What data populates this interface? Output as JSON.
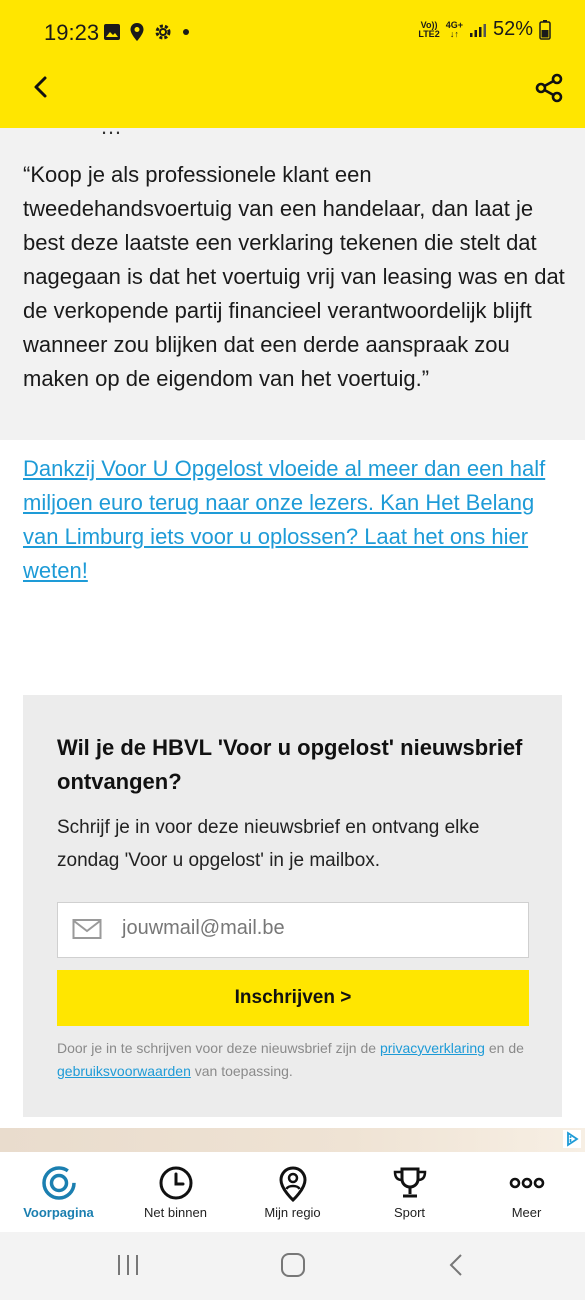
{
  "status_bar": {
    "time": "19:23",
    "network_top": "Vo))",
    "network_bottom": "LTE2",
    "data_top": "4G+",
    "data_bottom": "↓↑",
    "battery": "52%"
  },
  "appbar": {
    "color": "#ffe600"
  },
  "article": {
    "cut_text": "…",
    "quote": "“Koop je als professionele klant een tweedehandsvoertuig van een handelaar, dan laat je best deze laatste een verklaring tekenen die stelt dat nagegaan is dat het voertuig vrij van leasing was en dat de verkopende partij financieel verantwoordelijk blijft wanneer zou blijken dat een derde aanspraak zou maken op de eigendom van het voertuig.”",
    "cta_link": "Dankzij Voor U Opgelost vloeide al meer dan een half miljoen euro terug naar onze lezers. Kan Het Belang van Limburg iets voor u oplossen? Laat het ons hier weten! "
  },
  "newsletter": {
    "title": "Wil je de HBVL 'Voor u opgelost' nieuwsbrief ontvangen?",
    "text": "Schrijf je in voor deze nieuwsbrief en ontvang elke zondag 'Voor u opgelost' in je mailbox.",
    "email_placeholder": "jouwmail@mail.be",
    "subscribe_label": "Inschrijven >",
    "legal_prefix": "Door je in te schrijven voor deze nieuwsbrief zijn de ",
    "privacy_link": "privacyverklaring",
    "legal_middle": " en de ",
    "terms_link": "gebruiksvoorwaarden",
    "legal_suffix": " van toepassing."
  },
  "bottom_nav": {
    "items": [
      {
        "label": "Voorpagina",
        "icon": "home-ring-icon",
        "active": true
      },
      {
        "label": "Net binnen",
        "icon": "clock-icon",
        "active": false
      },
      {
        "label": "Mijn regio",
        "icon": "location-pin-icon",
        "active": false
      },
      {
        "label": "Sport",
        "icon": "trophy-icon",
        "active": false
      },
      {
        "label": "Meer",
        "icon": "more-dots-icon",
        "active": false
      }
    ]
  },
  "colors": {
    "brand_yellow": "#ffe600",
    "link_blue": "#1e9bd7",
    "active_blue": "#1b7fb0"
  }
}
